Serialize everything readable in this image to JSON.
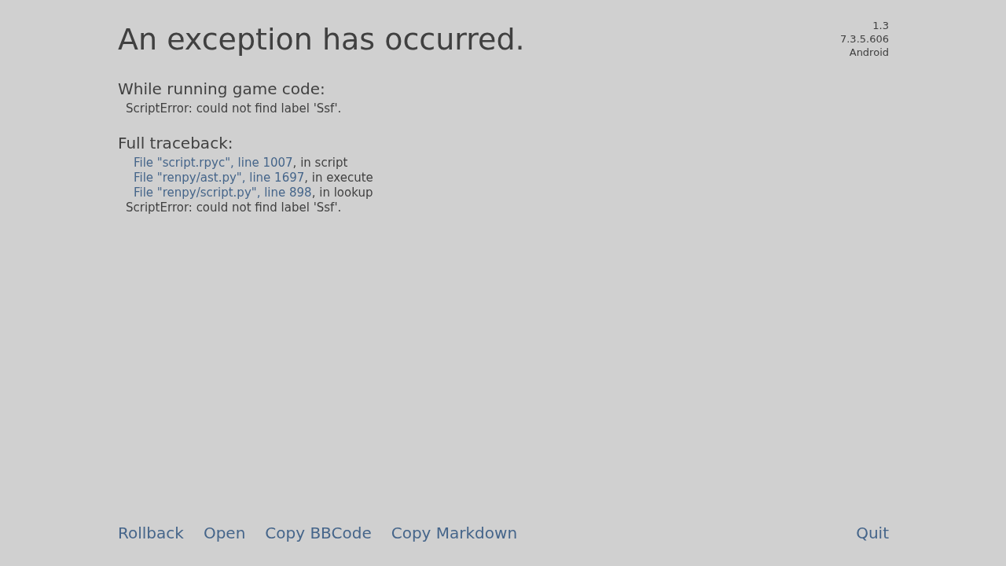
{
  "title": "An exception has occurred.",
  "version_info": [
    "1.3",
    "7.3.5.606",
    "Android"
  ],
  "game_code": {
    "heading": "While running game code:",
    "message": "ScriptError: could not find label 'Ssf'."
  },
  "traceback": {
    "heading": "Full traceback:",
    "frames": [
      {
        "link": "File \"script.rpyc\", line 1007",
        "rest": ", in script"
      },
      {
        "link": "File \"renpy/ast.py\", line 1697",
        "rest": ", in execute"
      },
      {
        "link": "File \"renpy/script.py\", line 898",
        "rest": ", in lookup"
      }
    ],
    "message": "ScriptError: could not find label 'Ssf'."
  },
  "buttons": [
    "Rollback",
    "Open",
    "Copy BBCode",
    "Copy Markdown"
  ],
  "quit_button": "Quit"
}
